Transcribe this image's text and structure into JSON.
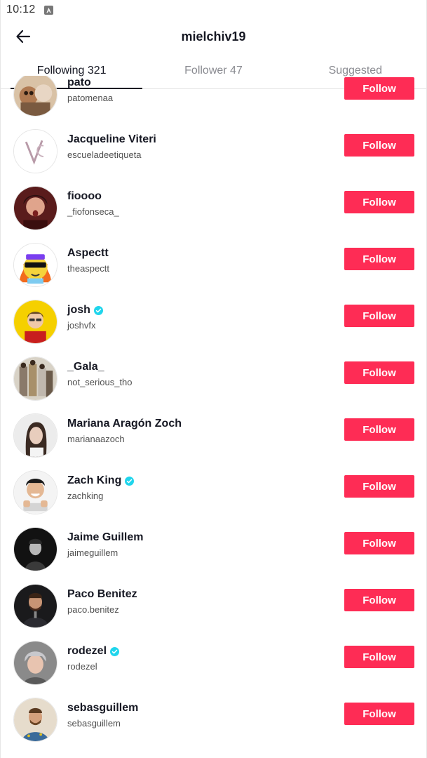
{
  "status_bar": {
    "time": "10:12",
    "notification_icon": "notification-a-icon"
  },
  "header": {
    "title": "mielchiv19",
    "back_icon": "arrow-left-icon"
  },
  "tabs": [
    {
      "label": "Following 321",
      "active": true
    },
    {
      "label": "Follower 47",
      "active": false
    },
    {
      "label": "Suggested",
      "active": false
    }
  ],
  "colors": {
    "accent": "#fe2c55",
    "verified": "#20d5ec",
    "text": "#161823",
    "subtext": "#505050"
  },
  "follow_label": "Follow",
  "users": [
    {
      "name": "pato",
      "username": "patomenaa",
      "verified": false
    },
    {
      "name": "Jacqueline Viteri",
      "username": "escueladeetiqueta",
      "verified": false
    },
    {
      "name": "fioooo",
      "username": "_fiofonseca_",
      "verified": false
    },
    {
      "name": "Aspectt",
      "username": "theaspectt",
      "verified": false
    },
    {
      "name": "josh",
      "username": "joshvfx",
      "verified": true
    },
    {
      "name": "_Gala_",
      "username": "not_serious_tho",
      "verified": false
    },
    {
      "name": "Mariana Aragón Zoch",
      "username": "marianaazoch",
      "verified": false
    },
    {
      "name": "Zach King",
      "username": "zachking",
      "verified": true
    },
    {
      "name": "Jaime Guillem",
      "username": "jaimeguillem",
      "verified": false
    },
    {
      "name": "Paco Benitez",
      "username": "paco.benitez",
      "verified": false
    },
    {
      "name": "rodezel",
      "username": "rodezel",
      "verified": true
    },
    {
      "name": "sebasguillem",
      "username": "sebasguillem",
      "verified": false
    }
  ]
}
